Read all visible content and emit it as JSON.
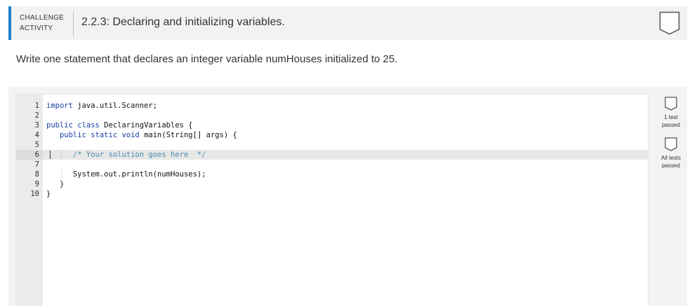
{
  "header": {
    "badge_line1": "CHALLENGE",
    "badge_line2": "ACTIVITY",
    "title": "2.2.3: Declaring and initializing variables.",
    "accent_color": "#1f81c9",
    "icon": "shield-icon"
  },
  "prompt": "Write one statement that declares an integer variable numHouses initialized to 25.",
  "editor": {
    "lines": [
      {
        "num": "1",
        "text": "import java.util.Scanner;"
      },
      {
        "num": "2",
        "text": ""
      },
      {
        "num": "3",
        "text": "public class DeclaringVariables {"
      },
      {
        "num": "4",
        "text": "   public static void main(String[] args) {"
      },
      {
        "num": "5",
        "text": ""
      },
      {
        "num": "6",
        "text": "      /* Your solution goes here  */"
      },
      {
        "num": "7",
        "text": ""
      },
      {
        "num": "8",
        "text": "      System.out.println(numHouses);"
      },
      {
        "num": "9",
        "text": "   }"
      },
      {
        "num": "10",
        "text": "}"
      }
    ],
    "active_line": 6
  },
  "status": {
    "test1_line1": "1 test",
    "test1_line2": "passed",
    "all_line1": "All tests",
    "all_line2": "passed"
  }
}
